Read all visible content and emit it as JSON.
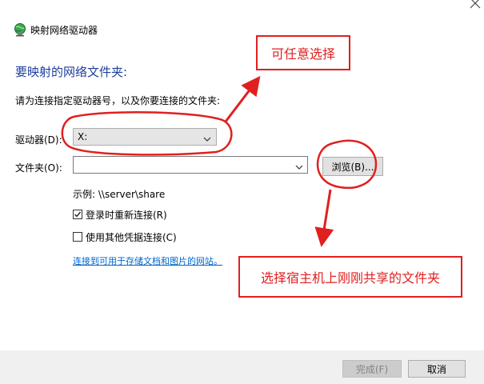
{
  "window": {
    "title": "映射网络驱动器",
    "icon": "network-drive-icon"
  },
  "dialog": {
    "heading": "要映射的网络文件夹:",
    "instruction": "请为连接指定驱动器号，以及你要连接的文件夹:",
    "drive_label": "驱动器(D):",
    "drive_value": "X:",
    "folder_label": "文件夹(O):",
    "folder_value": "",
    "browse_label": "浏览(B)...",
    "example_text": "示例: \\\\server\\share",
    "reconnect_label": "登录时重新连接(R)",
    "reconnect_checked": true,
    "other_credentials_label": "使用其他凭据连接(C)",
    "other_credentials_checked": false,
    "link_text": "连接到可用于存储文档和图片的网站。"
  },
  "footer": {
    "finish_label": "完成(F)",
    "finish_enabled": false,
    "cancel_label": "取消"
  },
  "annotations": {
    "callout_drive": "可任意选择",
    "callout_browse": "选择宿主机上刚刚共享的文件夹",
    "color": "#e02020"
  },
  "colors": {
    "heading": "#1e3f9e",
    "link": "#0066cc",
    "footer_bg": "#f0f0f0"
  }
}
